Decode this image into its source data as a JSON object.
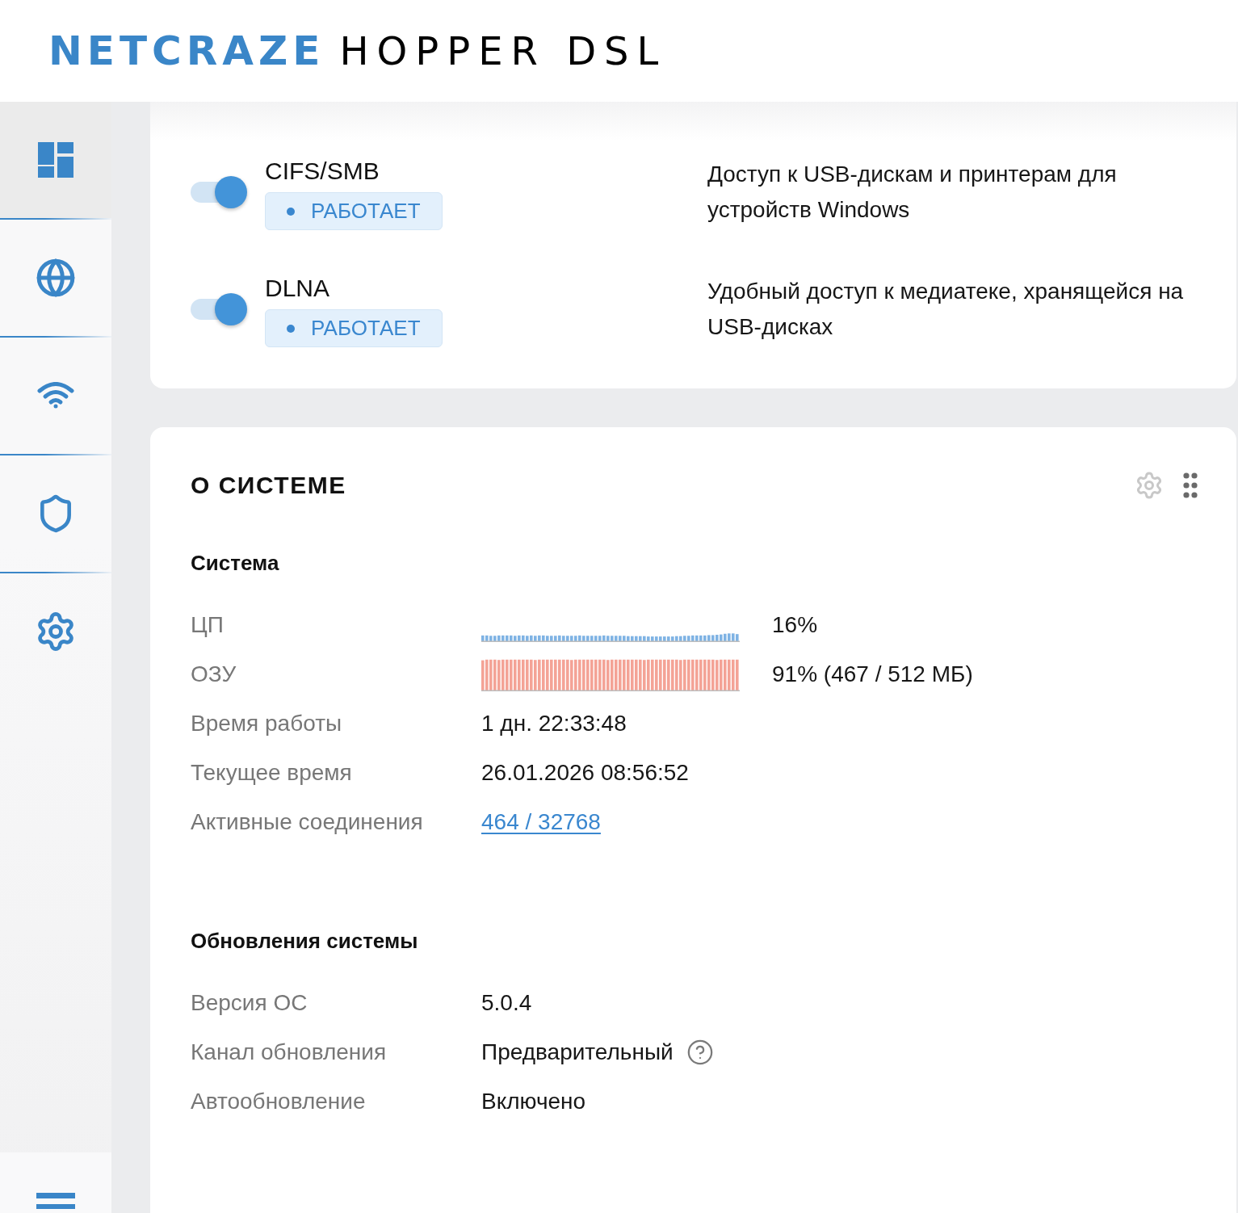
{
  "header": {
    "brand": "NETCRAZE",
    "model": "HOPPER DSL"
  },
  "sidebar": {
    "items": [
      {
        "selected": true
      },
      {
        "selected": false
      },
      {
        "selected": false
      },
      {
        "selected": false
      },
      {
        "selected": false
      }
    ]
  },
  "services": [
    {
      "name": "CIFS/SMB",
      "on": true,
      "status": "РАБОТАЕТ",
      "description": "Доступ к USB-дискам и принтерам для устройств Windows"
    },
    {
      "name": "DLNA",
      "on": true,
      "status": "РАБОТАЕТ",
      "description": "Удобный доступ к медиатеке, хранящейся на USB-дисках"
    }
  ],
  "system_card": {
    "title": "О СИСТЕМЕ",
    "sections": [
      {
        "title": "Система",
        "rows": [
          {
            "label": "ЦП",
            "kind": "graph",
            "color": "#7fb3e4",
            "value": "16%"
          },
          {
            "label": "ОЗУ",
            "kind": "graph",
            "color": "#f4a396",
            "value": "91% (467 / 512 МБ)"
          },
          {
            "label": "Время работы",
            "kind": "text",
            "value": "1 дн. 22:33:48"
          },
          {
            "label": "Текущее время",
            "kind": "text",
            "value": "26.01.2026 08:56:52"
          },
          {
            "label": "Активные соединения",
            "kind": "link",
            "value": "464 / 32768"
          }
        ]
      },
      {
        "title": "Обновления системы",
        "rows": [
          {
            "label": "Версия ОС",
            "kind": "text",
            "value": "5.0.4"
          },
          {
            "label": "Канал обновления",
            "kind": "help",
            "value": "Предварительный"
          },
          {
            "label": "Автообновление",
            "kind": "text",
            "value": "Включено"
          }
        ]
      }
    ]
  }
}
